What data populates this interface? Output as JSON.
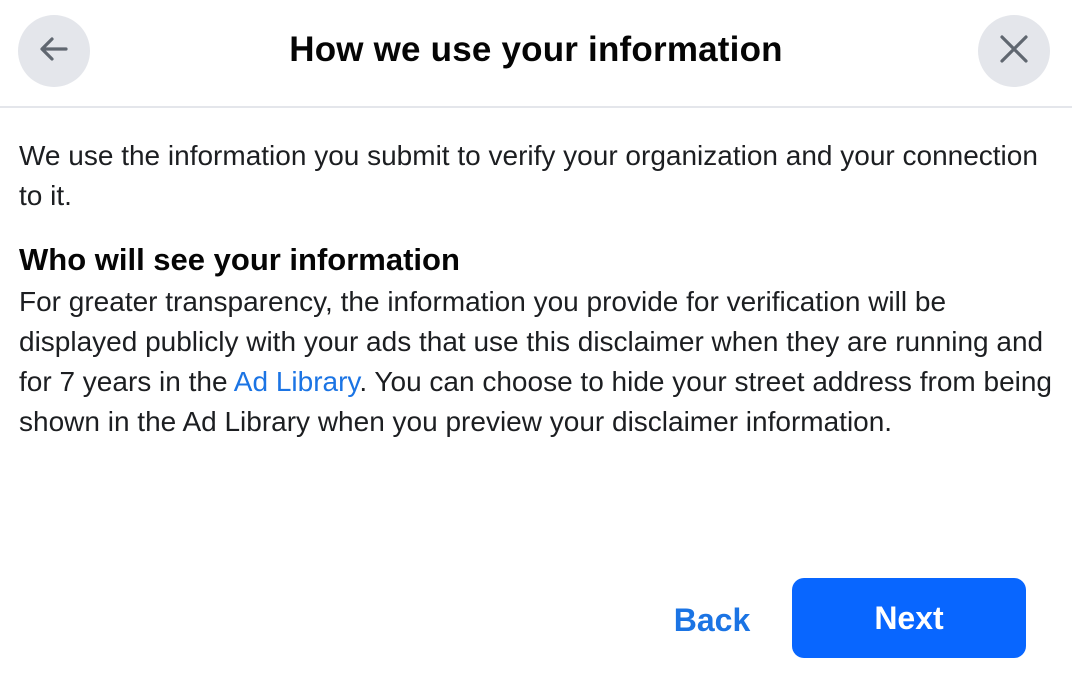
{
  "header": {
    "title": "How we use your information",
    "back_icon": "arrow-left-icon",
    "close_icon": "close-icon"
  },
  "content": {
    "intro": "We use the information you submit to verify your organization and your connection to it.",
    "section_heading": "Who will see your information",
    "section_text_before_link": "For greater transparency, the information you provide for verification will be displayed publicly with your ads that use this disclaimer when they are running and for 7 years in the ",
    "link_text": "Ad Library",
    "section_text_after_link": ". You can choose to hide your street address from being shown in the Ad Library when you preview your disclaimer information."
  },
  "footer": {
    "back_label": "Back",
    "next_label": "Next"
  },
  "colors": {
    "accent": "#0866ff",
    "link": "#1b74e4",
    "icon_button_bg": "#e4e6eb"
  }
}
